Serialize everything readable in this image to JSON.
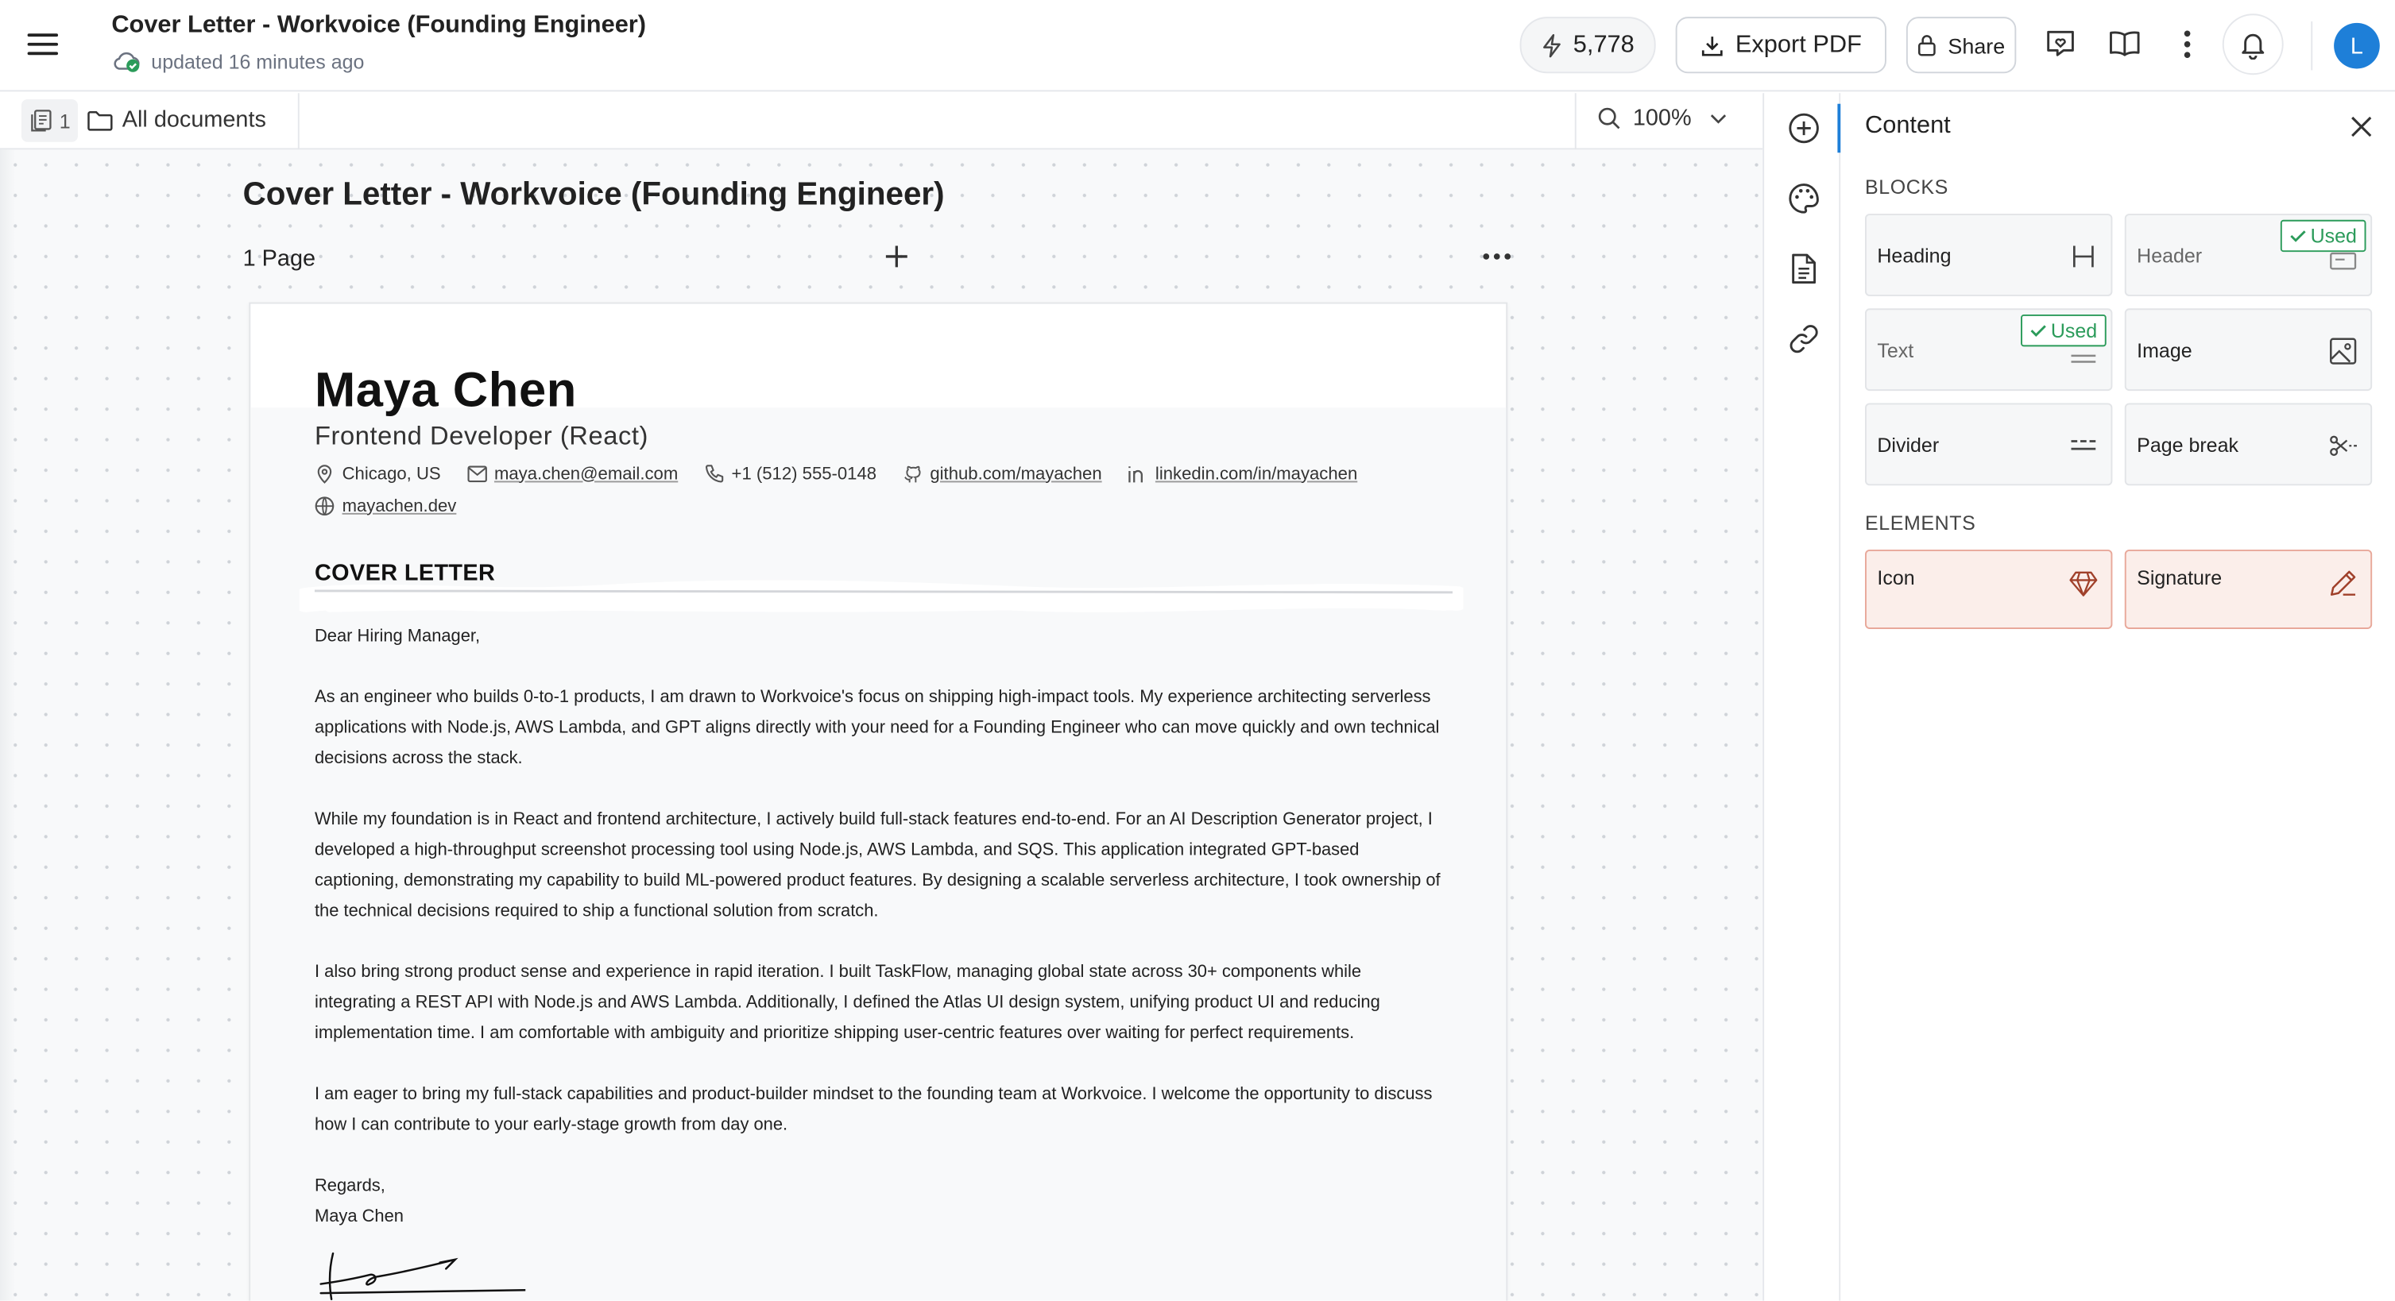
{
  "topbar": {
    "title": "Cover Letter - Workvoice (Founding Engineer)",
    "status": "updated 16 minutes ago",
    "credits": "5,778",
    "export_label": "Export PDF",
    "share_label": "Share",
    "avatar_initial": "L",
    "accent_color": "#1e7fd8"
  },
  "subbar": {
    "page_count": "1",
    "all_documents": "All documents",
    "zoom": "100%"
  },
  "canvas": {
    "doc_title": "Cover Letter - Workvoice (Founding Engineer)",
    "page_label": "1 Page"
  },
  "resume": {
    "name": "Maya Chen",
    "role": "Frontend Developer (React)",
    "contacts": {
      "location": "Chicago, US",
      "email": "maya.chen@email.com",
      "phone": "+1 (512) 555-0148",
      "github": "github.com/mayachen",
      "linkedin": "linkedin.com/in/mayachen",
      "website": "mayachen.dev"
    },
    "section_title": "COVER LETTER",
    "greeting": "Dear Hiring Manager,",
    "paragraphs": [
      "As an engineer who builds 0-to-1 products, I am drawn to Workvoice's focus on shipping high-impact tools. My experience architecting serverless applications with Node.js, AWS Lambda, and GPT aligns directly with your need for a Founding Engineer who can move quickly and own technical decisions across the stack.",
      "While my foundation is in React and frontend architecture, I actively build full-stack features end-to-end. For an AI Description Generator project, I developed a high-throughput screenshot processing tool using Node.js, AWS Lambda, and SQS. This application integrated GPT-based captioning, demonstrating my capability to build ML-powered product features. By designing a scalable serverless architecture, I took ownership of the technical decisions required to ship a functional solution from scratch.",
      "I also bring strong product sense and experience in rapid iteration. I built TaskFlow, managing global state across 30+ components while integrating a REST API with Node.js and AWS Lambda. Additionally, I defined the Atlas UI design system, unifying product UI and reducing implementation time. I am comfortable with ambiguity and prioritize shipping user-centric features over waiting for perfect requirements.",
      "I am eager to bring my full-stack capabilities and product-builder mindset to the founding team at Workvoice. I welcome the opportunity to discuss how I can contribute to your early-stage growth from day one."
    ],
    "closing": "Regards,",
    "signoff_name": "Maya Chen"
  },
  "panel": {
    "title": "Content",
    "blocks_label": "BLOCKS",
    "elements_label": "ELEMENTS",
    "used_label": "Used",
    "blocks": [
      {
        "label": "Heading",
        "icon": "heading-icon",
        "used": false
      },
      {
        "label": "Header",
        "icon": "header-icon",
        "used": true
      },
      {
        "label": "Text",
        "icon": "text-icon",
        "used": true
      },
      {
        "label": "Image",
        "icon": "image-icon",
        "used": false
      },
      {
        "label": "Divider",
        "icon": "divider-icon",
        "used": false
      },
      {
        "label": "Page break",
        "icon": "page-break-icon",
        "used": false
      }
    ],
    "elements": [
      {
        "label": "Icon",
        "icon": "diamond-icon"
      },
      {
        "label": "Signature",
        "icon": "pen-icon"
      }
    ],
    "used_color": "#2b9b5a",
    "element_accent": "#e8a89a"
  }
}
